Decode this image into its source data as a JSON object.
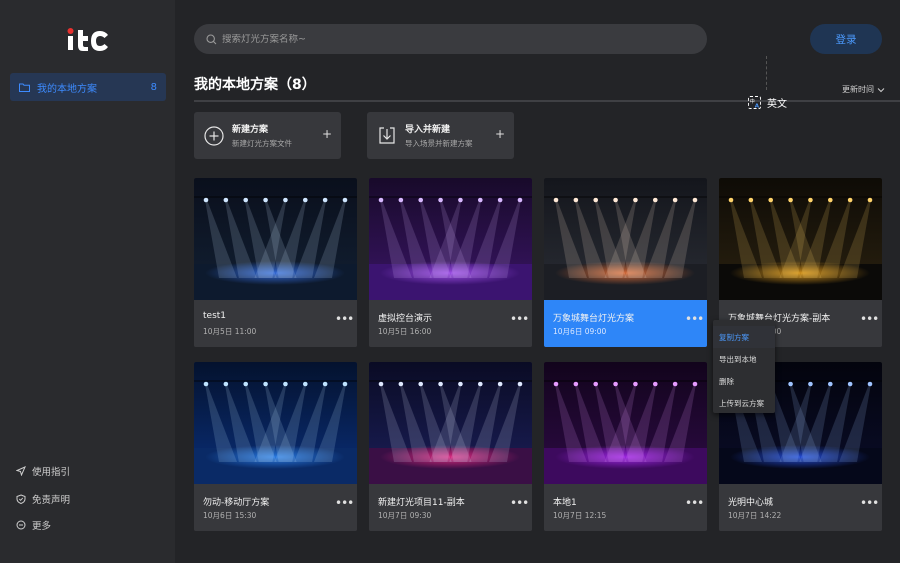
{
  "sidebar": {
    "logo": "itC",
    "item": {
      "label": "我的本地方案",
      "count": "8"
    },
    "bottom": [
      {
        "label": "使用指引",
        "icon": "navigation-icon"
      },
      {
        "label": "免责声明",
        "icon": "shield-icon"
      },
      {
        "label": "更多",
        "icon": "more-circle-icon"
      }
    ]
  },
  "header": {
    "search_placeholder": "搜索灯光方案名称~",
    "login_label": "登录",
    "page_title": "我的本地方案（8）",
    "sort_label": "更新时间",
    "translate_label": "英文"
  },
  "actions": [
    {
      "title": "新建方案",
      "subtitle": "新建灯光方案文件",
      "icon": "add-circle-icon"
    },
    {
      "title": "导入并新建",
      "subtitle": "导入场景并新建方案",
      "icon": "import-icon"
    }
  ],
  "cards": [
    {
      "name": "test1",
      "date": "10月5日  11:00",
      "theme": "blue-stage"
    },
    {
      "name": "虚拟控台演示",
      "date": "10月5日  16:00",
      "theme": "purple-stage"
    },
    {
      "name": "万象城舞台灯光方案",
      "date": "10月6日  09:00",
      "theme": "truss-lights",
      "active": true
    },
    {
      "name": "万象城舞台灯光方案-副本",
      "date": "10月6日  09:00",
      "theme": "gold-concert"
    },
    {
      "name": "勿动-移动厅方案",
      "date": "10月6日  15:30",
      "theme": "blue-burst"
    },
    {
      "name": "新建灯光项目11-副本",
      "date": "10月7日  09:30",
      "theme": "pink-arena"
    },
    {
      "name": "本地1",
      "date": "10月7日  12:15",
      "theme": "magenta-room"
    },
    {
      "name": "光明中心城",
      "date": "10月7日  14:22",
      "theme": "blue-beams"
    }
  ],
  "more_label": "•••",
  "context_menu": [
    "复制方案",
    "导出到本地",
    "删除",
    "上传到云方案"
  ],
  "colors": {
    "accent": "#2e86f8",
    "background": "#232427",
    "sidebar": "#2a2b2e",
    "card": "#37383c"
  }
}
